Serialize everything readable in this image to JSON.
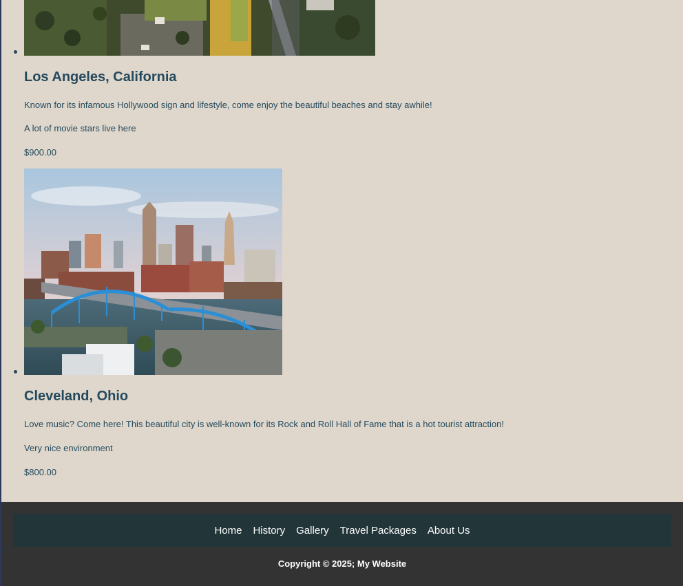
{
  "packages": [
    {
      "title": "Los Angeles, California",
      "description": "Known for its infamous Hollywood sign and lifestyle, come enjoy the beautiful beaches and stay awhile!",
      "note": "A lot of movie stars live here",
      "price": "$900.00"
    },
    {
      "title": "Cleveland, Ohio",
      "description": "Love music? Come here! This beautiful city is well-known for its Rock and Roll Hall of Fame that is a hot tourist attraction!",
      "note": "Very nice environment",
      "price": "$800.00"
    }
  ],
  "footer": {
    "nav": [
      "Home",
      "History",
      "Gallery",
      "Travel Packages",
      "About Us"
    ],
    "copyright": "Copyright © 2025; My Website"
  },
  "colors": {
    "page_bg": "#dfd7cc",
    "text": "#254a5e",
    "footer_bg": "#333333",
    "nav_bg": "#223539"
  }
}
